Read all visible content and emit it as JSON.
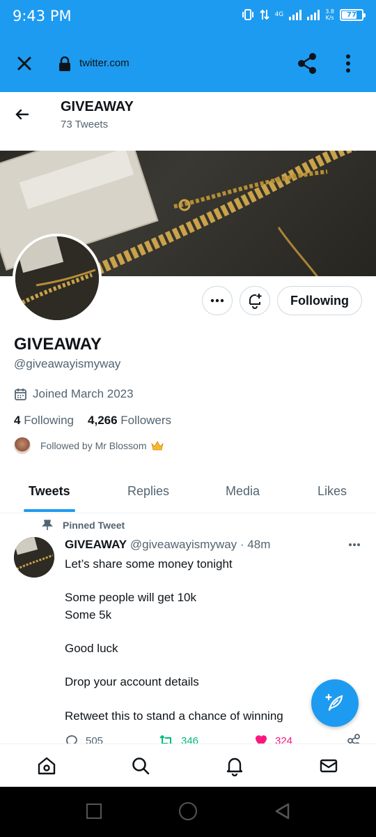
{
  "status_bar": {
    "time": "9:43 PM",
    "network": "4G",
    "speed_value": "3.8",
    "speed_unit": "K/s",
    "battery": "77"
  },
  "browser": {
    "url": "twitter.com"
  },
  "profile_header": {
    "title": "GIVEAWAY",
    "tweet_count": "73 Tweets"
  },
  "profile": {
    "display_name": "GIVEAWAY",
    "handle": "@giveawayismyway",
    "joined": "Joined March 2023",
    "following_count": "4",
    "following_label": "Following",
    "followers_count": "4,266",
    "followers_label": "Followers",
    "followed_by": "Followed by Mr Blossom",
    "following_button": "Following"
  },
  "tabs": [
    {
      "label": "Tweets",
      "active": true
    },
    {
      "label": "Replies",
      "active": false
    },
    {
      "label": "Media",
      "active": false
    },
    {
      "label": "Likes",
      "active": false
    }
  ],
  "pinned_tweet": {
    "pinned_label": "Pinned Tweet",
    "author_name": "GIVEAWAY",
    "author_meta": "@giveawayismyway · 48m",
    "lines": [
      "Let’s share some money tonight",
      "",
      "Some people will get 10k",
      "Some 5k",
      "",
      "Good luck",
      "",
      "Drop your account details",
      "",
      "Retweet this to stand a chance of winning"
    ],
    "reply_count": "505",
    "retweet_count": "346",
    "like_count": "324"
  },
  "colors": {
    "accent": "#1d9bf0",
    "text": "#0f1419",
    "muted": "#536471",
    "retweet": "#00ba7c",
    "like": "#f91880"
  },
  "icons": {
    "close": "close-icon",
    "lock": "lock-icon",
    "share": "share-icon",
    "more": "more-vertical-icon",
    "back": "back-arrow-icon",
    "calendar": "calendar-icon",
    "pin": "pin-icon",
    "compose": "compose-feather-icon",
    "home": "home-icon",
    "search": "search-icon",
    "bell": "bell-icon",
    "mail": "mail-icon"
  }
}
